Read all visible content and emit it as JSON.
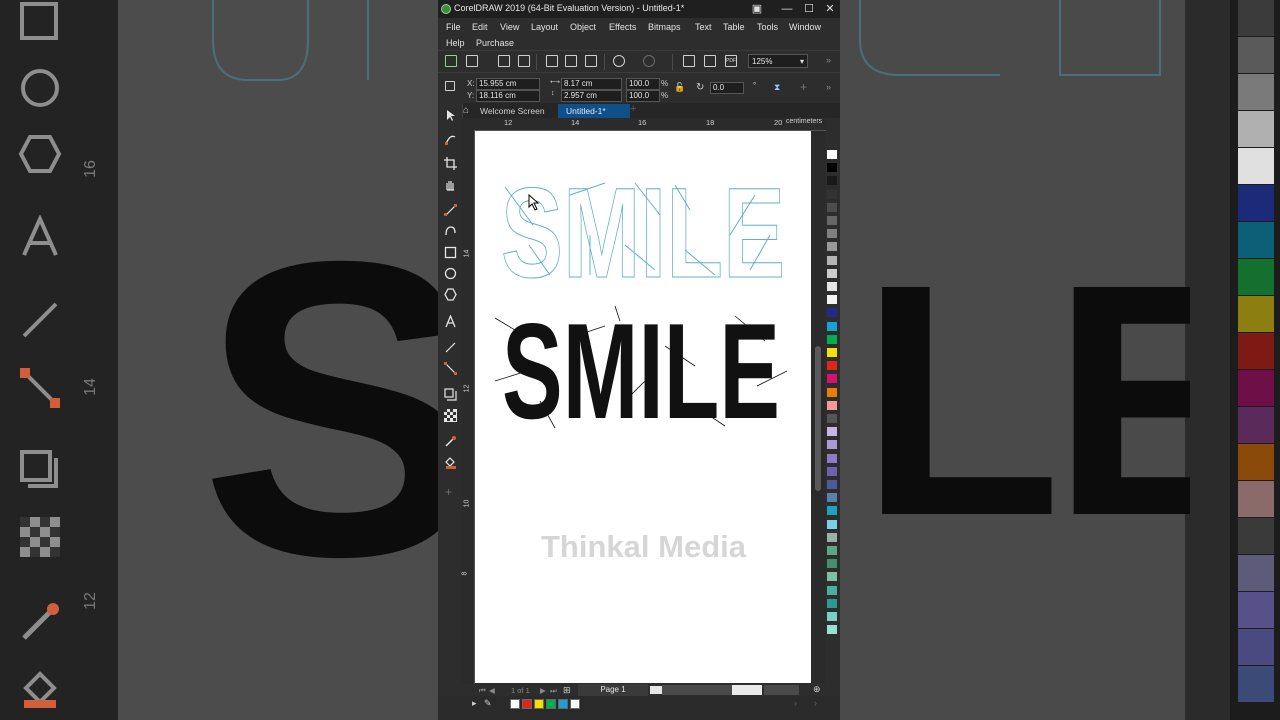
{
  "app": {
    "title": "CorelDRAW 2019 (64-Bit Evaluation Version) - Untitled-1*",
    "menus_row1": [
      "File",
      "Edit",
      "View",
      "Layout",
      "Object",
      "Effects",
      "Bitmaps",
      "Text",
      "Table",
      "Tools",
      "Window"
    ],
    "menus_row2": [
      "Help",
      "Purchase"
    ]
  },
  "toolbar": {
    "zoom": "125%"
  },
  "properties": {
    "x_label": "X:",
    "x_value": "15.955 cm",
    "y_label": "Y:",
    "y_value": "18.116 cm",
    "width": "8.17 cm",
    "height": "2.957 cm",
    "scale_x": "100.0",
    "scale_y": "100.0",
    "pct": "%",
    "rotation": "0.0",
    "degree": "°"
  },
  "tabs": {
    "welcome": "Welcome Screen",
    "document": "Untitled-1*",
    "add": "+"
  },
  "ruler": {
    "h_ticks": [
      "12",
      "14",
      "16",
      "18",
      "20"
    ],
    "unit": "centimeters",
    "v_ticks": [
      "14",
      "12",
      "10",
      "8"
    ]
  },
  "canvas": {
    "outline_text": "SMILE",
    "solid_text": "SMILE",
    "watermark": "Thinkal Media"
  },
  "status": {
    "page_counter": "1 of 1",
    "page_tab": "Page 1"
  },
  "colors": {
    "outline": "#5fb0c8",
    "fill": "#111111",
    "accent": "#0f4f8a",
    "palette": [
      "#ffffff",
      "#000000",
      "#1a1a1a",
      "#333333",
      "#4d4d4d",
      "#666666",
      "#808080",
      "#999999",
      "#b3b3b3",
      "#cccccc",
      "#e6e6e6",
      "#f2f2f2",
      "#1f2a8c",
      "#1aa0d8",
      "#00b050",
      "#f5e000",
      "#e0261a",
      "#d4126f",
      "#ef7d00",
      "#f29a9a",
      "#555555",
      "#c6b7e8",
      "#a79bd6",
      "#8b7cc4",
      "#6f5fb0",
      "#4d5a9c",
      "#5a7fb0",
      "#22a0c4",
      "#7ad0e8",
      "#9ab0a8",
      "#5aa88a",
      "#3f8f70",
      "#7cc0a8",
      "#48b0a0",
      "#2a9a94",
      "#78d0c0",
      "#9ae0d0"
    ],
    "bottom_swatches": [
      "#ffffff",
      "#e0261a",
      "#f5e000",
      "#00b050",
      "#1aa0d8",
      "#ffffff"
    ]
  }
}
